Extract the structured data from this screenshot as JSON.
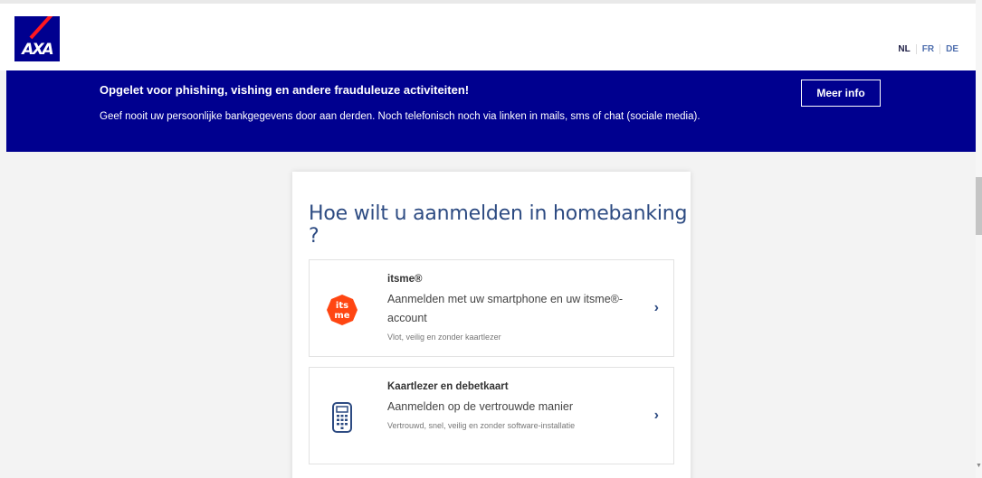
{
  "header": {
    "logo_text": "AXA",
    "languages": [
      {
        "code": "NL",
        "active": true
      },
      {
        "code": "FR",
        "active": false
      },
      {
        "code": "DE",
        "active": false
      }
    ]
  },
  "banner": {
    "title": "Opgelet voor phishing, vishing en andere frauduleuze activiteiten!",
    "text": "Geef nooit uw persoonlijke bankgegevens door aan derden. Noch telefonisch noch via linken in mails, sms of chat (sociale media).",
    "button_label": "Meer info"
  },
  "login": {
    "title": "Hoe wilt u aanmelden in homebanking ?",
    "options": [
      {
        "icon": "itsme-icon",
        "icon_text_top": "its",
        "icon_text_bottom": "me",
        "name": "itsme®",
        "description": "Aanmelden met uw smartphone en uw itsme®-account",
        "subtext": "Vlot, veilig en zonder kaartlezer"
      },
      {
        "icon": "card-reader-icon",
        "name": "Kaartlezer en debetkaart",
        "description": "Aanmelden op de vertrouwde manier",
        "subtext": "Vertrouwd, snel, veilig en zonder software-installatie"
      }
    ],
    "chevron": "›"
  },
  "colors": {
    "brand_blue": "#00008f",
    "brand_red": "#ff1721",
    "title_blue": "#2d4b82",
    "itsme_orange": "#ff4612"
  }
}
